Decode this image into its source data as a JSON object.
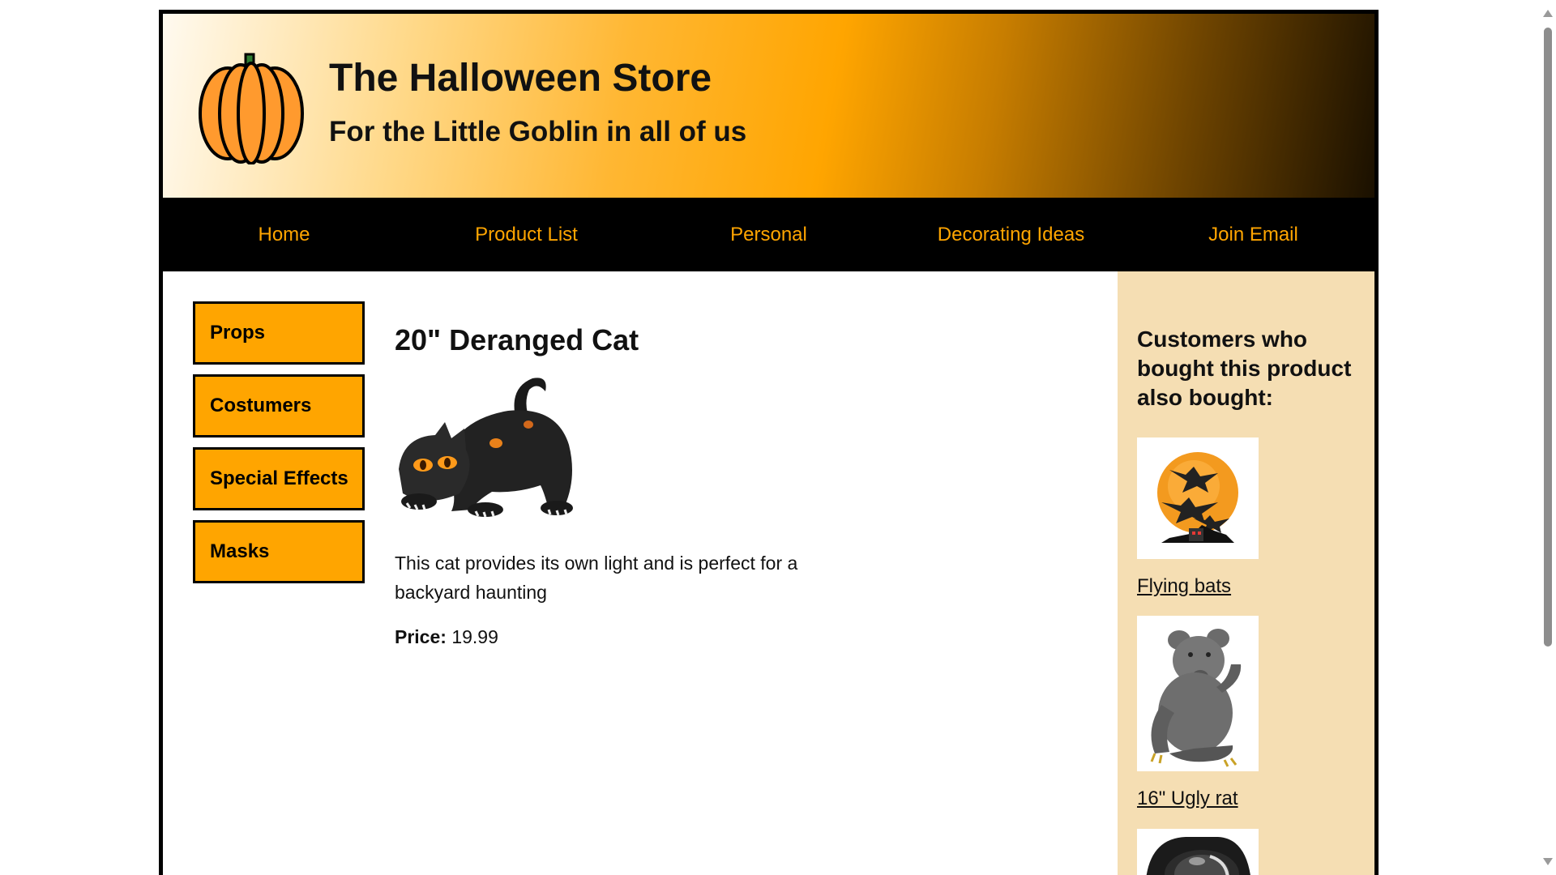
{
  "header": {
    "title": "The Halloween Store",
    "subtitle": "For the Little Goblin in all of us",
    "logo_icon": "pumpkin-icon"
  },
  "nav": {
    "items": [
      {
        "label": "Home"
      },
      {
        "label": "Product List"
      },
      {
        "label": "Personal"
      },
      {
        "label": "Decorating Ideas"
      },
      {
        "label": "Join Email"
      }
    ],
    "color": "#ffa500"
  },
  "categories": {
    "items": [
      {
        "label": "Props"
      },
      {
        "label": "Costumers"
      },
      {
        "label": "Special Effects"
      },
      {
        "label": "Masks"
      }
    ],
    "color": "#ffa500"
  },
  "product": {
    "title": "20\" Deranged Cat",
    "image_icon": "inflatable-cat-image",
    "description": "This cat provides its own light and is perfect for a backyard haunting",
    "price_label": "Price:",
    "price": "19.99"
  },
  "related": {
    "heading": "Customers who bought this product also bought:",
    "items": [
      {
        "label": "Flying bats",
        "image_icon": "flying-bats-image"
      },
      {
        "label": "16\" Ugly rat",
        "image_icon": "ugly-rat-image"
      },
      {
        "label": "",
        "image_icon": "spotlight-image"
      }
    ],
    "background": "#f5deb3"
  }
}
